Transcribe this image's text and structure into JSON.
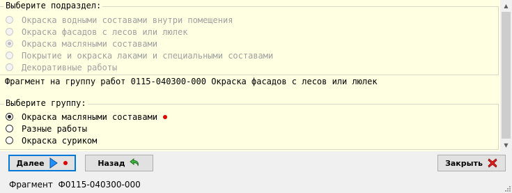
{
  "subsection": {
    "title": "Выберите подраздел:",
    "options": [
      {
        "label": "Окраска водными составами внутри помещения",
        "checked": false
      },
      {
        "label": "Окраска фасадов с лесов или люлек",
        "checked": false
      },
      {
        "label": "Окраска масляными составами",
        "checked": true
      },
      {
        "label": "Покрытие и окраска лаками и специальными составами",
        "checked": false
      },
      {
        "label": "Декоративные работы",
        "checked": false
      }
    ]
  },
  "fragment_text": "Фрагмент на группу работ 0115-040300-000 Окраска фасадов с лесов или люлек",
  "group": {
    "title": "Выберите группу:",
    "options": [
      {
        "label": "Окраска масляными составами",
        "checked": true
      },
      {
        "label": "Разные работы",
        "checked": false
      },
      {
        "label": "Окраска суриком",
        "checked": false
      }
    ]
  },
  "buttons": {
    "next": "Далее",
    "back": "Назад",
    "close": "Закрыть"
  },
  "status": {
    "label": "Фрагмент",
    "value": "Ф0115-040300-000"
  },
  "colors": {
    "panel_bg": "#ffffe1",
    "marker_red": "#e00000",
    "next_arrow": "#1e90ff",
    "close_x": "#e02020",
    "back_arrow": "#2e9b2e"
  }
}
